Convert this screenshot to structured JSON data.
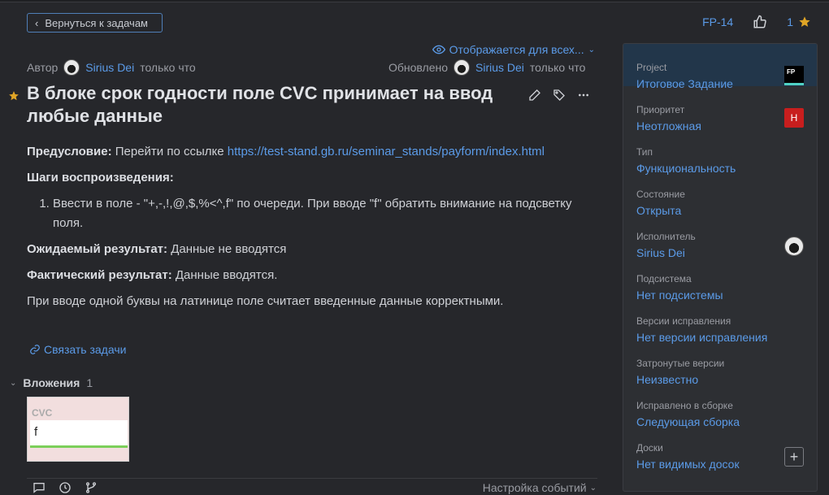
{
  "header": {
    "back_label": "Вернуться к задачам",
    "issue_id": "FP-14",
    "star_count": "1",
    "visibility": "Отображается для всех..."
  },
  "meta": {
    "author_label": "Автор",
    "author_name": "Sirius Dei",
    "author_time": "только что",
    "updated_label": "Обновлено",
    "updated_name": "Sirius Dei",
    "updated_time": "только что"
  },
  "issue": {
    "title": "В блоке срок годности поле CVC принимает на ввод любые данные",
    "precondition_label": "Предусловие:",
    "precondition_text": " Перейти по ссылке ",
    "precondition_link": "https://test-stand.gb.ru/seminar_stands/payform/index.html",
    "steps_label": "Шаги воспроизведения:",
    "steps": [
      "Ввести в поле - \"+,-,!,@,$,%<^,f\" по очереди. При вводе \"f\" обратить внимание на подсветку поля."
    ],
    "expected_label": "Ожидаемый результат:",
    "expected_text": " Данные не вводятся",
    "actual_label": "Фактический результат:",
    "actual_text": " Данные вводятся.",
    "note": "При вводе одной буквы на латинице поле считает введенные данные корректными.",
    "link_issues": "Связать задачи"
  },
  "attachments": {
    "label": "Вложения",
    "count": "1",
    "thumb_label": "CVC",
    "thumb_value": "f"
  },
  "footer": {
    "event_settings": "Настройка событий"
  },
  "sidebar": {
    "project_icon_text": "FP",
    "priority_icon_text": "H",
    "fields": [
      {
        "label": "Project",
        "value": "Итоговое Задание"
      },
      {
        "label": "Приоритет",
        "value": "Неотложная"
      },
      {
        "label": "Тип",
        "value": "Функциональность"
      },
      {
        "label": "Состояние",
        "value": "Открыта"
      },
      {
        "label": "Исполнитель",
        "value": "Sirius Dei"
      },
      {
        "label": "Подсистема",
        "value": "Нет подсистемы"
      },
      {
        "label": "Версии исправления",
        "value": "Нет версии исправления"
      },
      {
        "label": "Затронутые версии",
        "value": "Неизвестно"
      },
      {
        "label": "Исправлено в сборке",
        "value": "Следующая сборка"
      },
      {
        "label": "Доски",
        "value": "Нет видимых досок"
      }
    ]
  },
  "colors": {
    "background": "#26272b",
    "accent": "#5b9be8",
    "star": "#e0a526",
    "priority": "#c81e1e"
  },
  "icons": {
    "back": "chevron-left-icon",
    "like": "thumb-up-icon",
    "star": "star-icon",
    "visibility": "eye-icon",
    "edit": "pencil-icon",
    "tag": "tag-icon",
    "more": "more-icon",
    "link": "link-icon",
    "collapse": "chevron-down-icon",
    "comment": "comment-icon",
    "history": "history-icon",
    "vcs": "branch-icon",
    "add": "plus-icon"
  }
}
